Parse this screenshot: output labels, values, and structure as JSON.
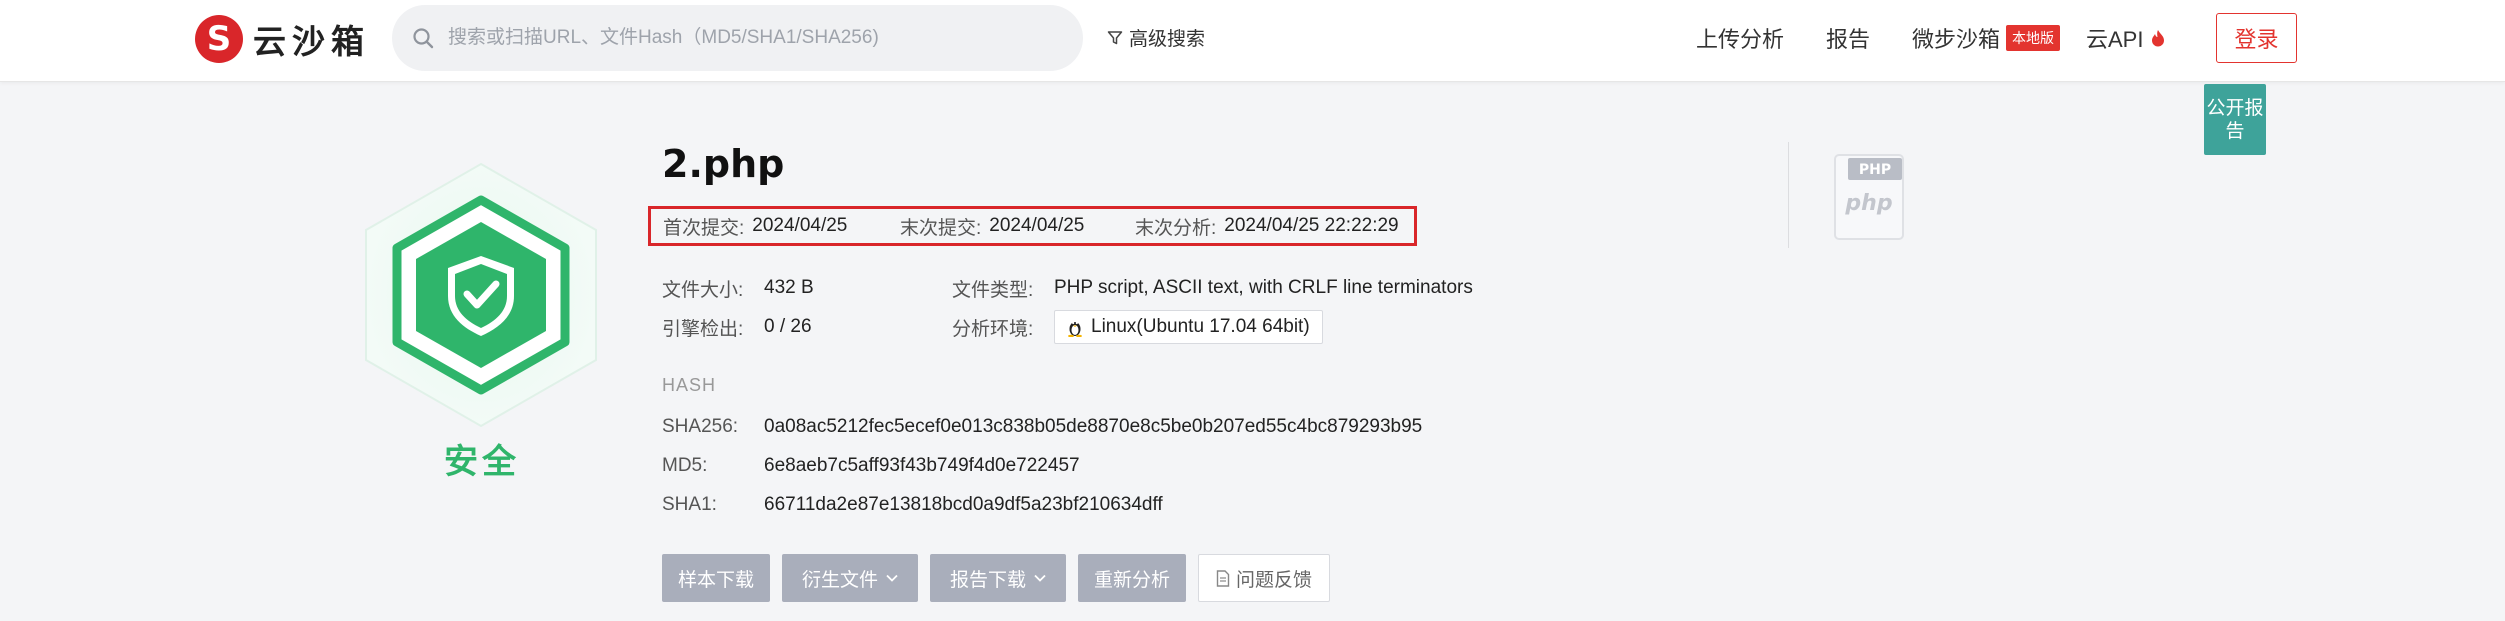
{
  "header": {
    "logo_text": "云沙箱",
    "logo_mark": "S",
    "search_placeholder": "搜索或扫描URL、文件Hash（MD5/SHA1/SHA256)",
    "advanced_search": "高级搜索",
    "nav": {
      "upload": "上传分析",
      "report": "报告",
      "local": "微步沙箱",
      "local_badge": "本地版",
      "api": "云API"
    },
    "login": "登录"
  },
  "public_tag": "公开报告",
  "verdict": "安全",
  "file": {
    "name": "2.php",
    "first_submit_label": "首次提交:",
    "first_submit": "2024/04/25",
    "last_submit_label": "末次提交:",
    "last_submit": "2024/04/25",
    "last_analysis_label": "末次分析:",
    "last_analysis": "2024/04/25 22:22:29",
    "size_label": "文件大小:",
    "size": "432 B",
    "engine_label": "引擎检出:",
    "engine": "0 / 26",
    "type_label": "文件类型:",
    "type": "PHP script, ASCII text, with CRLF line terminators",
    "env_label": "分析环境:",
    "env": "Linux(Ubuntu 17.04 64bit)"
  },
  "hash": {
    "heading": "HASH",
    "sha256_label": "SHA256:",
    "sha256": "0a08ac5212fec5ecef0e013c838b05de8870e8c5be0b207ed55c4bc879293b95",
    "md5_label": "MD5:",
    "md5": "6e8aeb7c5aff93f43b749f4d0e722457",
    "sha1_label": "SHA1:",
    "sha1": "66711da2e87e13818bcd0a9df5a23bf210634dff"
  },
  "actions": {
    "download_sample": "样本下载",
    "derived_files": "衍生文件",
    "download_report": "报告下载",
    "reanalyze": "重新分析",
    "feedback": "问题反馈"
  },
  "php_icon": {
    "tag": "PHP",
    "text": "php"
  },
  "colors": {
    "safe_green": "#2fb56b",
    "brand_red": "#d9262a",
    "teal": "#3ea39a",
    "button_gray": "#a9aebb"
  }
}
